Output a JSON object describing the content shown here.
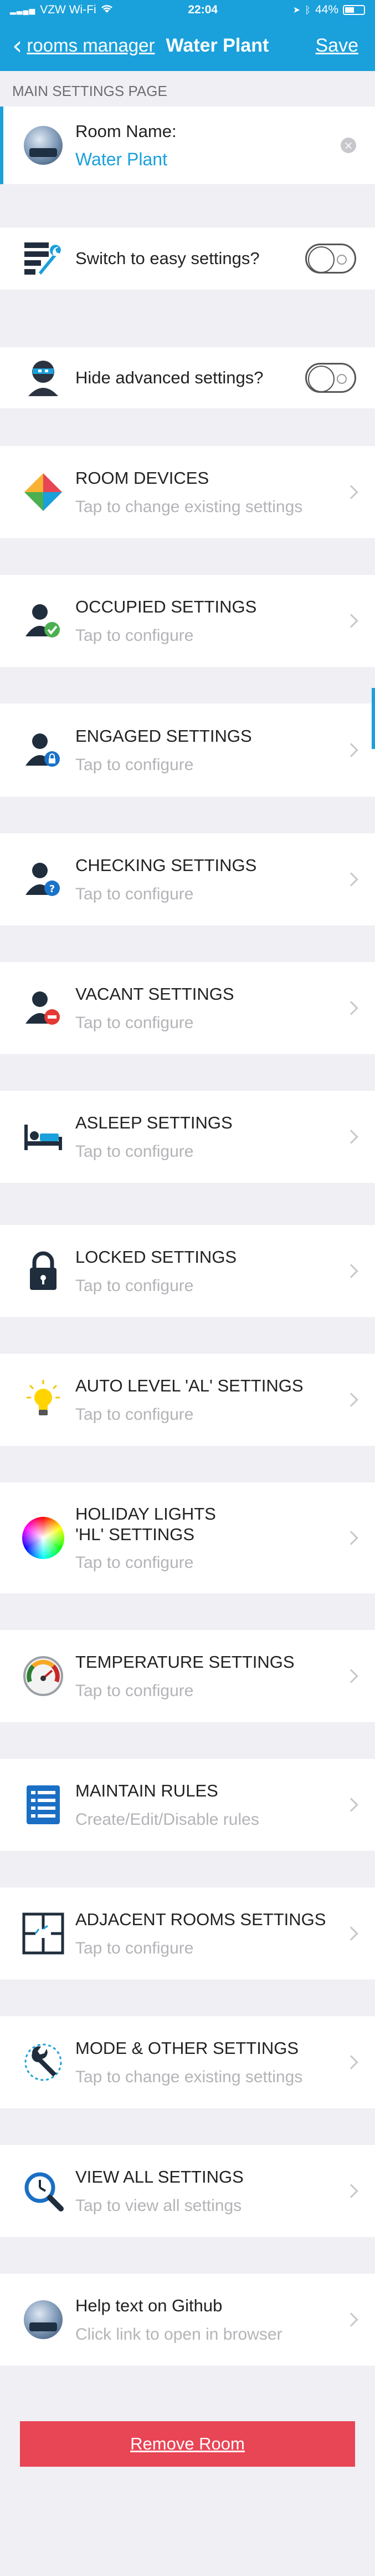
{
  "statusbar": {
    "carrier": "VZW Wi-Fi",
    "time": "22:04",
    "battery": "44%"
  },
  "navbar": {
    "back_label": "rooms manager",
    "title": "Water Plant",
    "save_label": "Save"
  },
  "section": {
    "header": "MAIN SETTINGS PAGE"
  },
  "room_name": {
    "label": "Room Name:",
    "value": "Water Plant"
  },
  "toggles": {
    "easy": {
      "label": "Switch to easy settings?",
      "on": false
    },
    "advanced": {
      "label": "Hide advanced settings?",
      "on": false
    }
  },
  "rows": [
    {
      "title": "ROOM DEVICES",
      "sub": "Tap to change existing settings"
    },
    {
      "title": "OCCUPIED SETTINGS",
      "sub": "Tap to configure"
    },
    {
      "title": "ENGAGED SETTINGS",
      "sub": "Tap to configure"
    },
    {
      "title": "CHECKING SETTINGS",
      "sub": "Tap to configure"
    },
    {
      "title": "VACANT SETTINGS",
      "sub": "Tap to configure"
    },
    {
      "title": "ASLEEP SETTINGS",
      "sub": "Tap to configure"
    },
    {
      "title": "LOCKED SETTINGS",
      "sub": "Tap to configure"
    },
    {
      "title": "AUTO LEVEL 'AL' SETTINGS",
      "sub": "Tap to configure"
    },
    {
      "title": "HOLIDAY LIGHTS 'HL' SETTINGS",
      "sub": "Tap to configure"
    },
    {
      "title": "TEMPERATURE SETTINGS",
      "sub": "Tap to configure"
    },
    {
      "title": "MAINTAIN RULES",
      "sub": "Create/Edit/Disable rules"
    },
    {
      "title": "ADJACENT ROOMS SETTINGS",
      "sub": "Tap to configure"
    },
    {
      "title": "MODE & OTHER SETTINGS",
      "sub": "Tap to change existing settings"
    },
    {
      "title": "VIEW ALL SETTINGS",
      "sub": "Tap to view all settings"
    },
    {
      "title": "Help text on Github",
      "sub": "Click link to open in browser"
    }
  ],
  "remove_button": "Remove Room",
  "colors": {
    "accent": "#1aa0db",
    "danger": "#e84555",
    "background": "#efeff4"
  }
}
